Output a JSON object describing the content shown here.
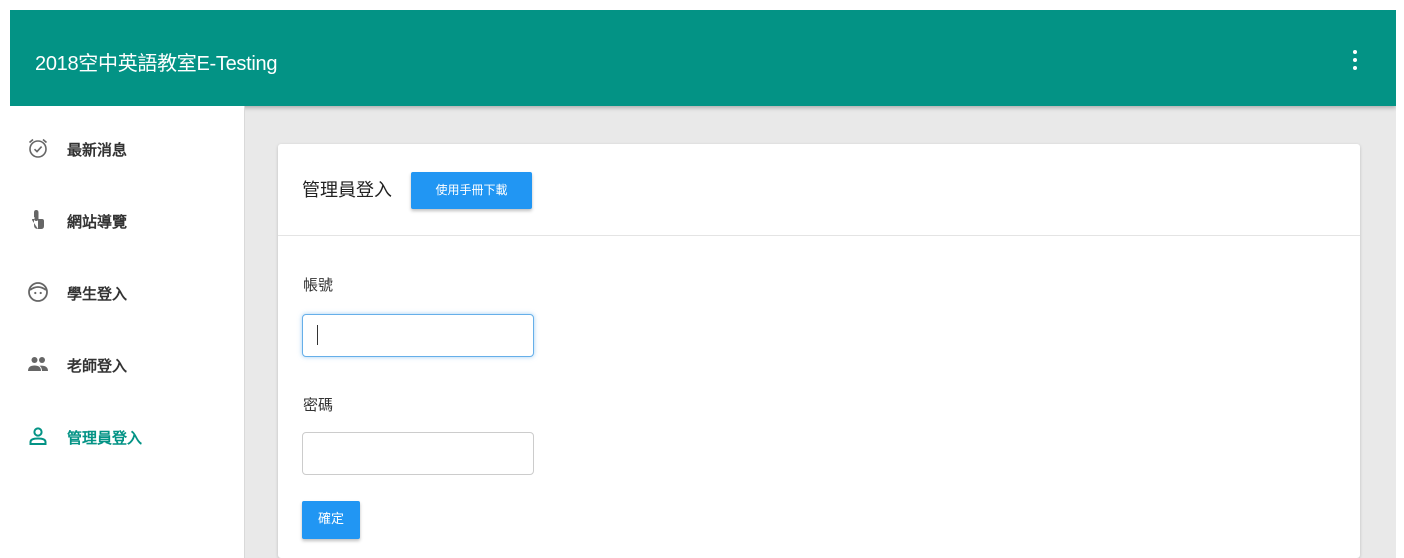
{
  "app": {
    "title": "2018空中英語教室E-Testing",
    "header_color": "#039385"
  },
  "sidebar": {
    "items": [
      {
        "label": "最新消息",
        "icon": "alarm-check-icon",
        "active": false
      },
      {
        "label": "網站導覽",
        "icon": "touch-hand-icon",
        "active": false
      },
      {
        "label": "學生登入",
        "icon": "face-icon",
        "active": false
      },
      {
        "label": "老師登入",
        "icon": "people-icon",
        "active": false
      },
      {
        "label": "管理員登入",
        "icon": "person-outline-icon",
        "active": true
      }
    ]
  },
  "card": {
    "title": "管理員登入",
    "manual_button_label": "使用手冊下載"
  },
  "form": {
    "account_label": "帳號",
    "account_value": "",
    "password_label": "密碼",
    "password_value": "",
    "submit_label": "確定"
  },
  "colors": {
    "accent": "#039385",
    "button": "#2196f3"
  }
}
